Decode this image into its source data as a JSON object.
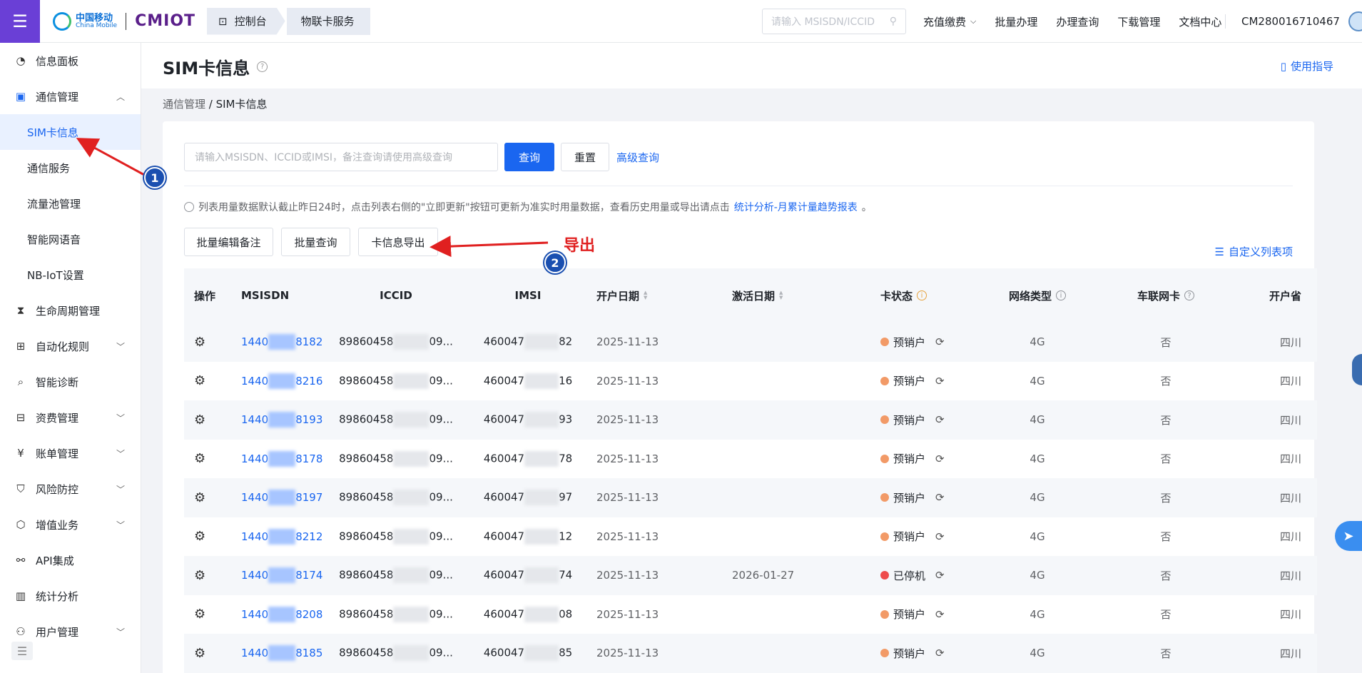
{
  "topbar": {
    "brand_cn": "中国移动",
    "brand_en": "China Mobile",
    "brand_iot": "CMIOT",
    "tabs": [
      {
        "label": "控制台"
      },
      {
        "label": "物联卡服务"
      }
    ],
    "search_placeholder": "请输入 MSISDN/ICCID",
    "nav": [
      {
        "label": "充值缴费",
        "dropdown": true
      },
      {
        "label": "批量办理"
      },
      {
        "label": "办理查询"
      },
      {
        "label": "下载管理"
      },
      {
        "label": "文档中心"
      }
    ],
    "account": "CM280016710467"
  },
  "sidebar": {
    "items": [
      {
        "label": "信息面板",
        "icon": "dashboard-icon"
      },
      {
        "label": "通信管理",
        "icon": "comm-icon",
        "expanded": true
      },
      {
        "label": "SIM卡信息",
        "sub": true,
        "active": true
      },
      {
        "label": "通信服务",
        "sub": true
      },
      {
        "label": "流量池管理",
        "sub": true
      },
      {
        "label": "智能网语音",
        "sub": true
      },
      {
        "label": "NB-IoT设置",
        "sub": true
      },
      {
        "label": "生命周期管理",
        "icon": "hourglass-icon"
      },
      {
        "label": "自动化规则",
        "icon": "rules-icon",
        "chevron": true
      },
      {
        "label": "智能诊断",
        "icon": "diagnose-icon"
      },
      {
        "label": "资费管理",
        "icon": "tariff-icon",
        "chevron": true
      },
      {
        "label": "账单管理",
        "icon": "bill-icon",
        "chevron": true
      },
      {
        "label": "风险防控",
        "icon": "shield-icon",
        "chevron": true
      },
      {
        "label": "增值业务",
        "icon": "cube-icon",
        "chevron": true
      },
      {
        "label": "API集成",
        "icon": "api-icon"
      },
      {
        "label": "统计分析",
        "icon": "stats-icon"
      },
      {
        "label": "用户管理",
        "icon": "user-icon",
        "chevron": true
      }
    ]
  },
  "page": {
    "title": "SIM卡信息",
    "guide": "使用指导",
    "breadcrumb_parent": "通信管理",
    "breadcrumb_sep": " / ",
    "breadcrumb_current": "SIM卡信息"
  },
  "filters": {
    "search_placeholder": "请输入MSISDN、ICCID或IMSI，备注查询请使用高级查询",
    "query_btn": "查询",
    "reset_btn": "重置",
    "advanced": "高级查询"
  },
  "tip": {
    "text": "列表用量数据默认截止昨日24时，点击列表右侧的\"立即更新\"按钮可更新为准实时用量数据，查看历史用量或导出请点击",
    "link": "统计分析-月累计量趋势报表",
    "end": "。"
  },
  "actions": {
    "batch_remark": "批量编辑备注",
    "batch_query": "批量查询",
    "export": "卡信息导出",
    "custom_cols": "自定义列表项"
  },
  "annotations": {
    "badge1": "1",
    "badge2": "2",
    "export_label": "导出"
  },
  "table": {
    "headers": {
      "op": "操作",
      "msisdn": "MSISDN",
      "iccid": "ICCID",
      "imsi": "IMSI",
      "open_date": "开户日期",
      "activate_date": "激活日期",
      "status": "卡状态",
      "net_type": "网络类型",
      "car_card": "车联网卡",
      "province": "开户省"
    },
    "rows": [
      {
        "ms_pre": "1440",
        "ms_suf": "8182",
        "ic_pre": "89860458",
        "ic_suf": "09...",
        "im_pre": "460047",
        "im_suf": "82",
        "open": "2025-11-13",
        "act": "",
        "status": "预销户",
        "status_color": "#f29a67",
        "net": "4G",
        "car": "否",
        "prov": "四川"
      },
      {
        "ms_pre": "1440",
        "ms_suf": "8216",
        "ic_pre": "89860458",
        "ic_suf": "09...",
        "im_pre": "460047",
        "im_suf": "16",
        "open": "2025-11-13",
        "act": "",
        "status": "预销户",
        "status_color": "#f29a67",
        "net": "4G",
        "car": "否",
        "prov": "四川"
      },
      {
        "ms_pre": "1440",
        "ms_suf": "8193",
        "ic_pre": "89860458",
        "ic_suf": "09...",
        "im_pre": "460047",
        "im_suf": "93",
        "open": "2025-11-13",
        "act": "",
        "status": "预销户",
        "status_color": "#f29a67",
        "net": "4G",
        "car": "否",
        "prov": "四川"
      },
      {
        "ms_pre": "1440",
        "ms_suf": "8178",
        "ic_pre": "89860458",
        "ic_suf": "09...",
        "im_pre": "460047",
        "im_suf": "78",
        "open": "2025-11-13",
        "act": "",
        "status": "预销户",
        "status_color": "#f29a67",
        "net": "4G",
        "car": "否",
        "prov": "四川"
      },
      {
        "ms_pre": "1440",
        "ms_suf": "8197",
        "ic_pre": "89860458",
        "ic_suf": "09...",
        "im_pre": "460047",
        "im_suf": "97",
        "open": "2025-11-13",
        "act": "",
        "status": "预销户",
        "status_color": "#f29a67",
        "net": "4G",
        "car": "否",
        "prov": "四川"
      },
      {
        "ms_pre": "1440",
        "ms_suf": "8212",
        "ic_pre": "89860458",
        "ic_suf": "09...",
        "im_pre": "460047",
        "im_suf": "12",
        "open": "2025-11-13",
        "act": "",
        "status": "预销户",
        "status_color": "#f29a67",
        "net": "4G",
        "car": "否",
        "prov": "四川"
      },
      {
        "ms_pre": "1440",
        "ms_suf": "8174",
        "ic_pre": "89860458",
        "ic_suf": "09...",
        "im_pre": "460047",
        "im_suf": "74",
        "open": "2025-11-13",
        "act": "2026-01-27",
        "status": "已停机",
        "status_color": "#ee4b4b",
        "net": "4G",
        "car": "否",
        "prov": "四川"
      },
      {
        "ms_pre": "1440",
        "ms_suf": "8208",
        "ic_pre": "89860458",
        "ic_suf": "09...",
        "im_pre": "460047",
        "im_suf": "08",
        "open": "2025-11-13",
        "act": "",
        "status": "预销户",
        "status_color": "#f29a67",
        "net": "4G",
        "car": "否",
        "prov": "四川"
      },
      {
        "ms_pre": "1440",
        "ms_suf": "8185",
        "ic_pre": "89860458",
        "ic_suf": "09...",
        "im_pre": "460047",
        "im_suf": "85",
        "open": "2025-11-13",
        "act": "",
        "status": "预销户",
        "status_color": "#f29a67",
        "net": "4G",
        "car": "否",
        "prov": "四川"
      }
    ]
  },
  "colors": {
    "accent": "#1a66f0",
    "menu_bg": "#6a3fd6",
    "annotation_red": "#e02020",
    "badge_blue": "#1a4fb0"
  }
}
